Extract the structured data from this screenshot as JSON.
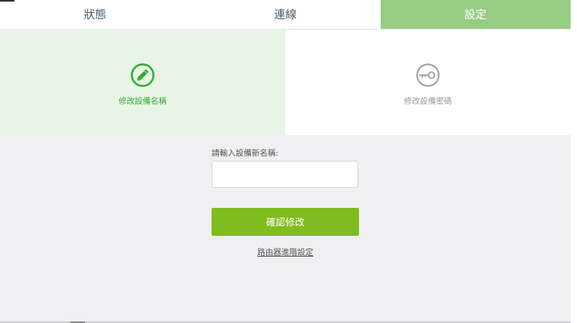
{
  "tabs": [
    {
      "label": "狀態",
      "active": false
    },
    {
      "label": "連線",
      "active": false
    },
    {
      "label": "設定",
      "active": true
    }
  ],
  "options": {
    "rename": {
      "label": "修改設備名稱",
      "icon": "pencil-circle-icon",
      "selected": true
    },
    "password": {
      "label": "修改設備密碼",
      "icon": "key-circle-icon",
      "selected": false
    }
  },
  "form": {
    "prompt": "請輸入設備新名稱:",
    "input_value": "",
    "input_placeholder": "",
    "confirm_label": "確認修改",
    "advanced_link": "路由器進階設定"
  },
  "colors": {
    "tab_active_bg": "#96cd82",
    "selected_bg": "#e8f5e6",
    "selected_accent": "#2fae33",
    "button_bg": "#80bc1d",
    "page_bg": "#f0f0f2"
  }
}
